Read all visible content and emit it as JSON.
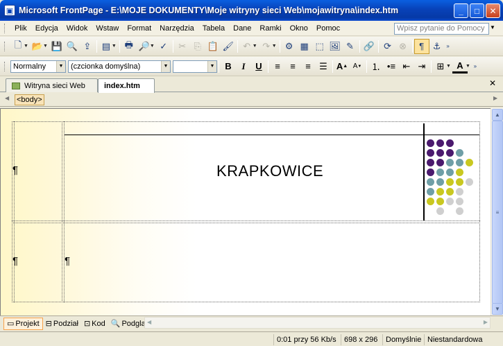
{
  "window": {
    "title": "Microsoft FrontPage - E:\\MOJE DOKUMENTY\\Moje witryny sieci Web\\mojawitryna\\index.htm"
  },
  "menu": {
    "items": [
      "Plik",
      "Edycja",
      "Widok",
      "Wstaw",
      "Format",
      "Narzędzia",
      "Tabela",
      "Dane",
      "Ramki",
      "Okno",
      "Pomoc"
    ],
    "help_placeholder": "Wpisz pytanie do Pomocy"
  },
  "formatting": {
    "style": "Normalny",
    "font": "(czcionka domyślna)",
    "size": ""
  },
  "tabs": [
    {
      "label": "Witryna sieci Web",
      "active": false
    },
    {
      "label": "index.htm",
      "active": true
    }
  ],
  "tagbar": {
    "tag": "<body>"
  },
  "document": {
    "heading": "KRAPKOWICE",
    "pilcrow": "¶"
  },
  "views": [
    {
      "label": "Projekt",
      "active": true
    },
    {
      "label": "Podział",
      "active": false
    },
    {
      "label": "Kod",
      "active": false
    },
    {
      "label": "Podgląd",
      "active": false
    }
  ],
  "status": {
    "download": "0:01 przy 56 Kb/s",
    "size": "698 x 296",
    "mode": "Domyślnie",
    "nonstandard": "Niestandardowa"
  },
  "colors": {
    "purple": "#4b1a6e",
    "teal": "#6f9fa6",
    "yellow": "#c9c820",
    "gray": "#cfcfcf"
  }
}
